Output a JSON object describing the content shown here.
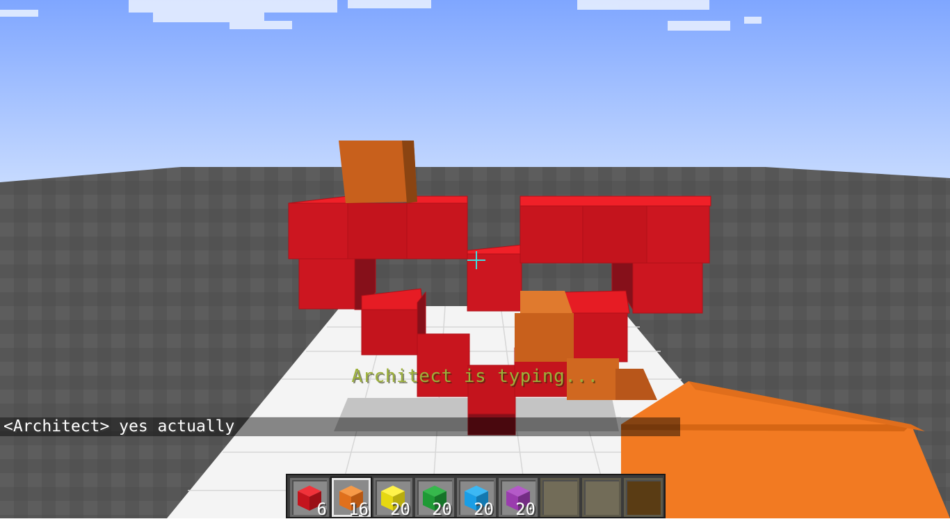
{
  "status_message": "Architect is typing...",
  "chat": {
    "message": "<Architect> yes actually"
  },
  "hotbar": {
    "selected_index": 1,
    "slots": [
      {
        "name": "red-block",
        "color": "#e0161e",
        "count": "6"
      },
      {
        "name": "orange-block",
        "color": "#f07a20",
        "count": "16"
      },
      {
        "name": "yellow-block",
        "color": "#f0e41a",
        "count": "20"
      },
      {
        "name": "green-block",
        "color": "#1f9a36",
        "count": "20"
      },
      {
        "name": "blue-block",
        "color": "#1a9ee6",
        "count": "20"
      },
      {
        "name": "purple-block",
        "color": "#9a3cae",
        "count": "20"
      },
      {
        "name": "empty-slot"
      },
      {
        "name": "empty-slot"
      },
      {
        "name": "empty-slot"
      }
    ]
  }
}
